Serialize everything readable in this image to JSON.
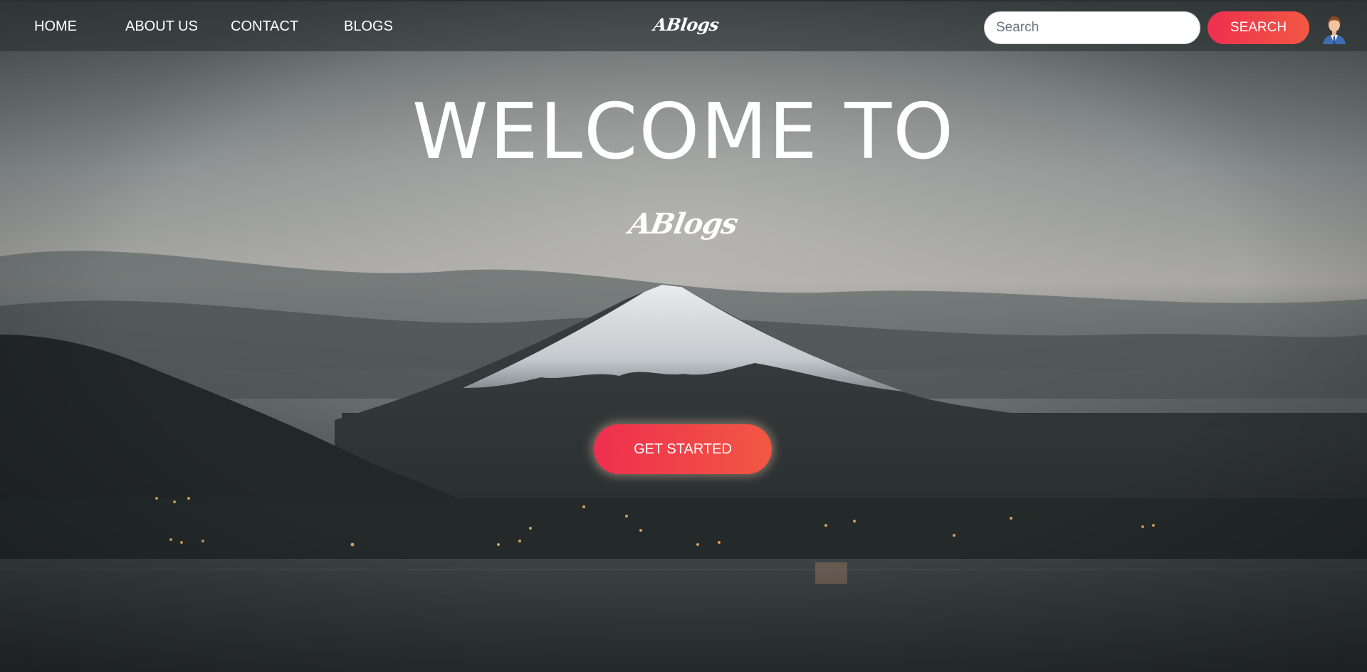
{
  "nav": {
    "links": [
      "HOME",
      "ABOUT US",
      "CONTACT",
      "BLOGS"
    ],
    "brand": "ABlogs",
    "search": {
      "placeholder": "Search",
      "value": ""
    },
    "search_button": "SEARCH",
    "avatar_icon": "user-avatar-icon"
  },
  "hero": {
    "title": "WELCOME TO",
    "brand": "ABlogs",
    "cta": "GET STARTED",
    "background": "mountain-lake-dusk-photo"
  },
  "colors": {
    "accent_start": "#ee2f4f",
    "accent_end": "#f25843",
    "text": "#ffffff"
  }
}
